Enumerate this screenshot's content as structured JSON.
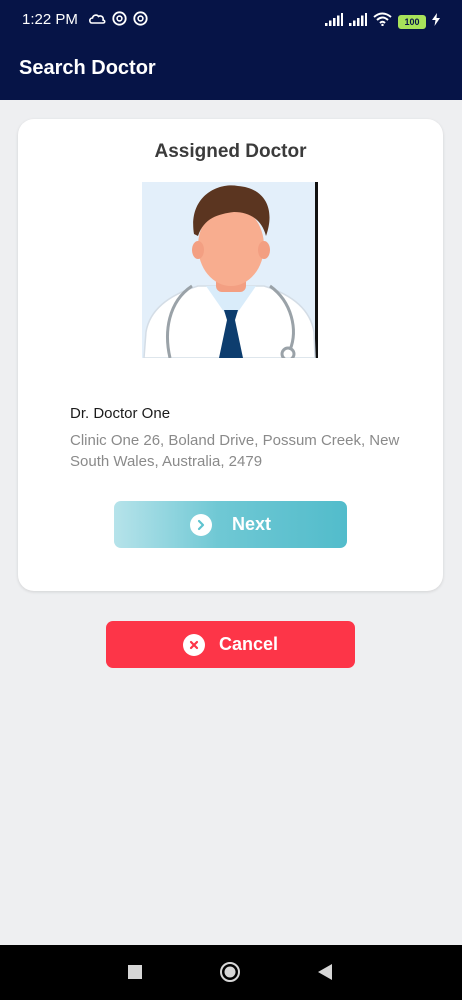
{
  "status_bar": {
    "time": "1:22 PM",
    "battery": "100",
    "left_icons": [
      "cloud-icon",
      "at-sign-icon",
      "at-sign-icon"
    ],
    "right_icons": [
      "signal-icon",
      "signal-icon",
      "wifi-icon",
      "battery-icon",
      "charging-icon"
    ]
  },
  "app_bar": {
    "title": "Search Doctor"
  },
  "card": {
    "title": "Assigned Doctor",
    "doctor_name": "Dr. Doctor One",
    "address": "Clinic One 26, Boland Drive, Possum Creek, New South Wales, Australia, 2479"
  },
  "buttons": {
    "next_label": "Next",
    "next_icon": "chevron-right-circle-icon",
    "cancel_label": "Cancel",
    "cancel_icon": "close-circle-icon"
  },
  "nav_bar": {
    "items": [
      "recents-square-icon",
      "home-circle-icon",
      "back-triangle-icon"
    ]
  },
  "colors": {
    "app_bar": "#061447",
    "background": "#eeeff1",
    "next_gradient_start": "#b6e3ea",
    "next_gradient_end": "#52bccb",
    "cancel": "#fd3548"
  }
}
